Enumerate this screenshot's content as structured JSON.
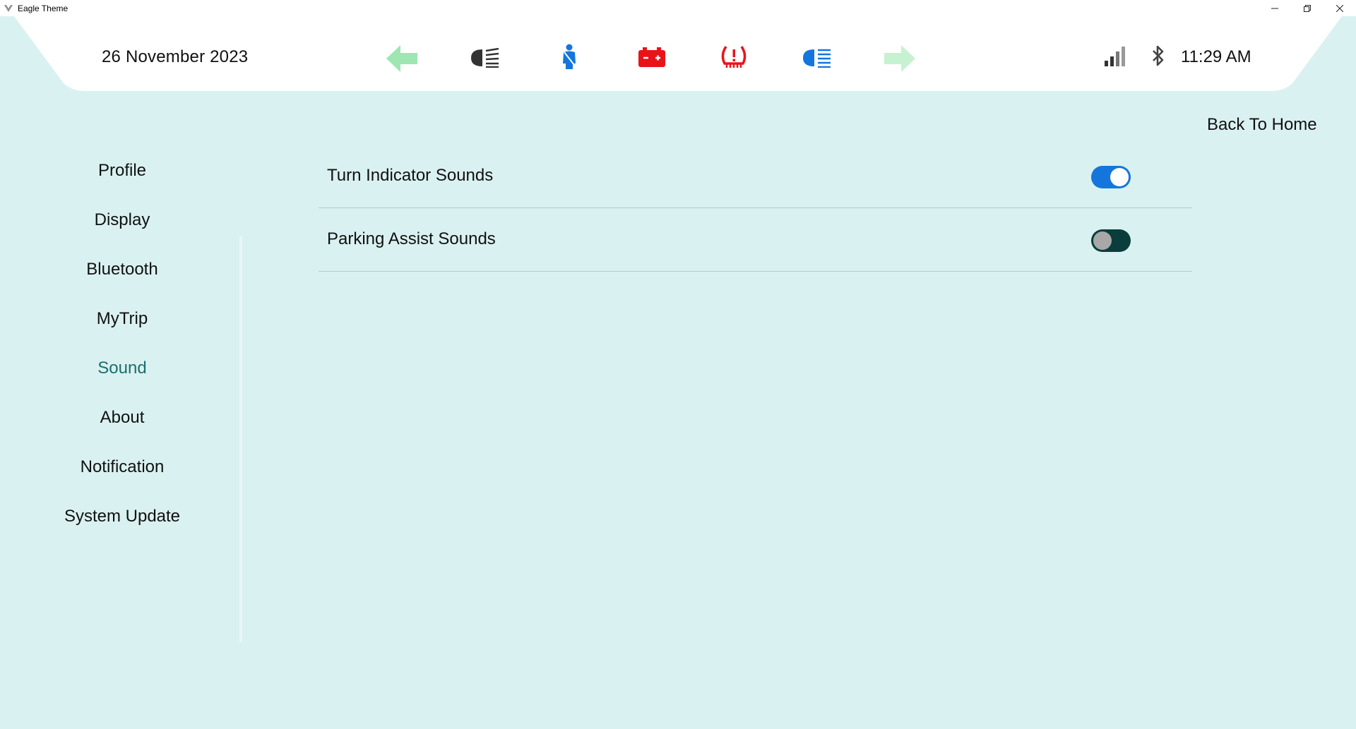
{
  "window": {
    "title": "Eagle Theme",
    "controls": {
      "minimize": "–",
      "restore": "❐",
      "close": "✕"
    }
  },
  "header": {
    "date": "26 November 2023",
    "time": "11:29 AM",
    "icons": [
      "left-turn-indicator-icon",
      "low-beam-headlight-icon",
      "seatbelt-warning-icon",
      "battery-warning-icon",
      "tire-pressure-warning-icon",
      "high-beam-headlight-icon",
      "right-turn-indicator-icon",
      "signal-strength-icon",
      "bluetooth-icon"
    ],
    "colors": {
      "turn_left": "#9ee6b2",
      "turn_right": "#c6f2d2",
      "low_beam": "#333333",
      "seatbelt": "#1476dd",
      "battery": "#e8141a",
      "tire_pressure": "#e8141a",
      "high_beam": "#1476dd"
    }
  },
  "back_home_label": "Back To Home",
  "sidebar": {
    "items": [
      {
        "label": "Profile",
        "active": false
      },
      {
        "label": "Display",
        "active": false
      },
      {
        "label": "Bluetooth",
        "active": false
      },
      {
        "label": "MyTrip",
        "active": false
      },
      {
        "label": "Sound",
        "active": true
      },
      {
        "label": "About",
        "active": false
      },
      {
        "label": "Notification",
        "active": false
      },
      {
        "label": "System Update",
        "active": false
      }
    ],
    "active_color": "#1c6e6e"
  },
  "settings": [
    {
      "label": "Turn Indicator Sounds",
      "enabled": true
    },
    {
      "label": "Parking Assist Sounds",
      "enabled": false
    }
  ],
  "theme": {
    "background": "#daf1f1",
    "header_background": "#ffffff",
    "toggle_on": "#1476dd",
    "toggle_off": "#0b3d3c"
  }
}
